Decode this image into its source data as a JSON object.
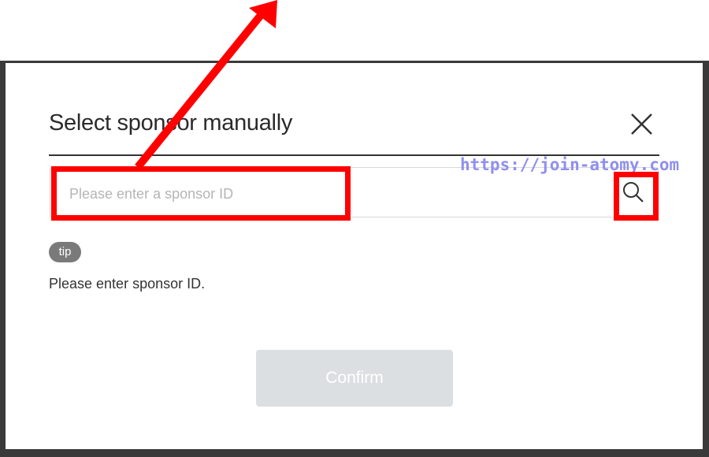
{
  "dialog": {
    "title": "Select sponsor manually",
    "close_icon": "close-icon",
    "search": {
      "placeholder": "Please enter a sponsor ID",
      "value": "",
      "icon": "search-icon"
    },
    "tip": {
      "badge": "tip",
      "text": "Please enter sponsor ID."
    },
    "confirm_label": "Confirm"
  },
  "watermark": "https://join-atomy.com",
  "colors": {
    "annotation": "#ff0000",
    "tip_badge": "#7a7a7a",
    "confirm_disabled": "#dcdfe2",
    "watermark": "#8f8ff0"
  }
}
